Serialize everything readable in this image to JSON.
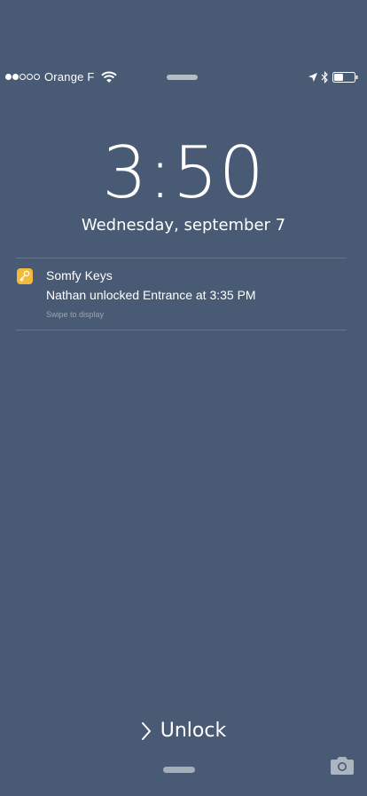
{
  "status_bar": {
    "signal_strength": 2,
    "signal_max": 5,
    "carrier": "Orange F",
    "wifi_icon": "wifi-icon",
    "location_icon": "location-arrow-icon",
    "bluetooth_icon": "bluetooth-icon",
    "battery_icon": "battery-icon",
    "battery_level": 0.45
  },
  "lock_screen": {
    "time": "3:50",
    "date": "Wednesday, september 7"
  },
  "notification": {
    "app_icon": "somfy-keys-app-icon",
    "app_icon_color": "#f4ba3c",
    "app_name": "Somfy Keys",
    "message": "Nathan unlocked Entrance at 3:35 PM",
    "hint": "Swipe to display"
  },
  "unlock": {
    "icon": "chevron-right-icon",
    "label": "Unlock"
  },
  "camera": {
    "icon": "camera-icon"
  },
  "colors": {
    "background": "#485a74",
    "text": "#ffffff"
  }
}
